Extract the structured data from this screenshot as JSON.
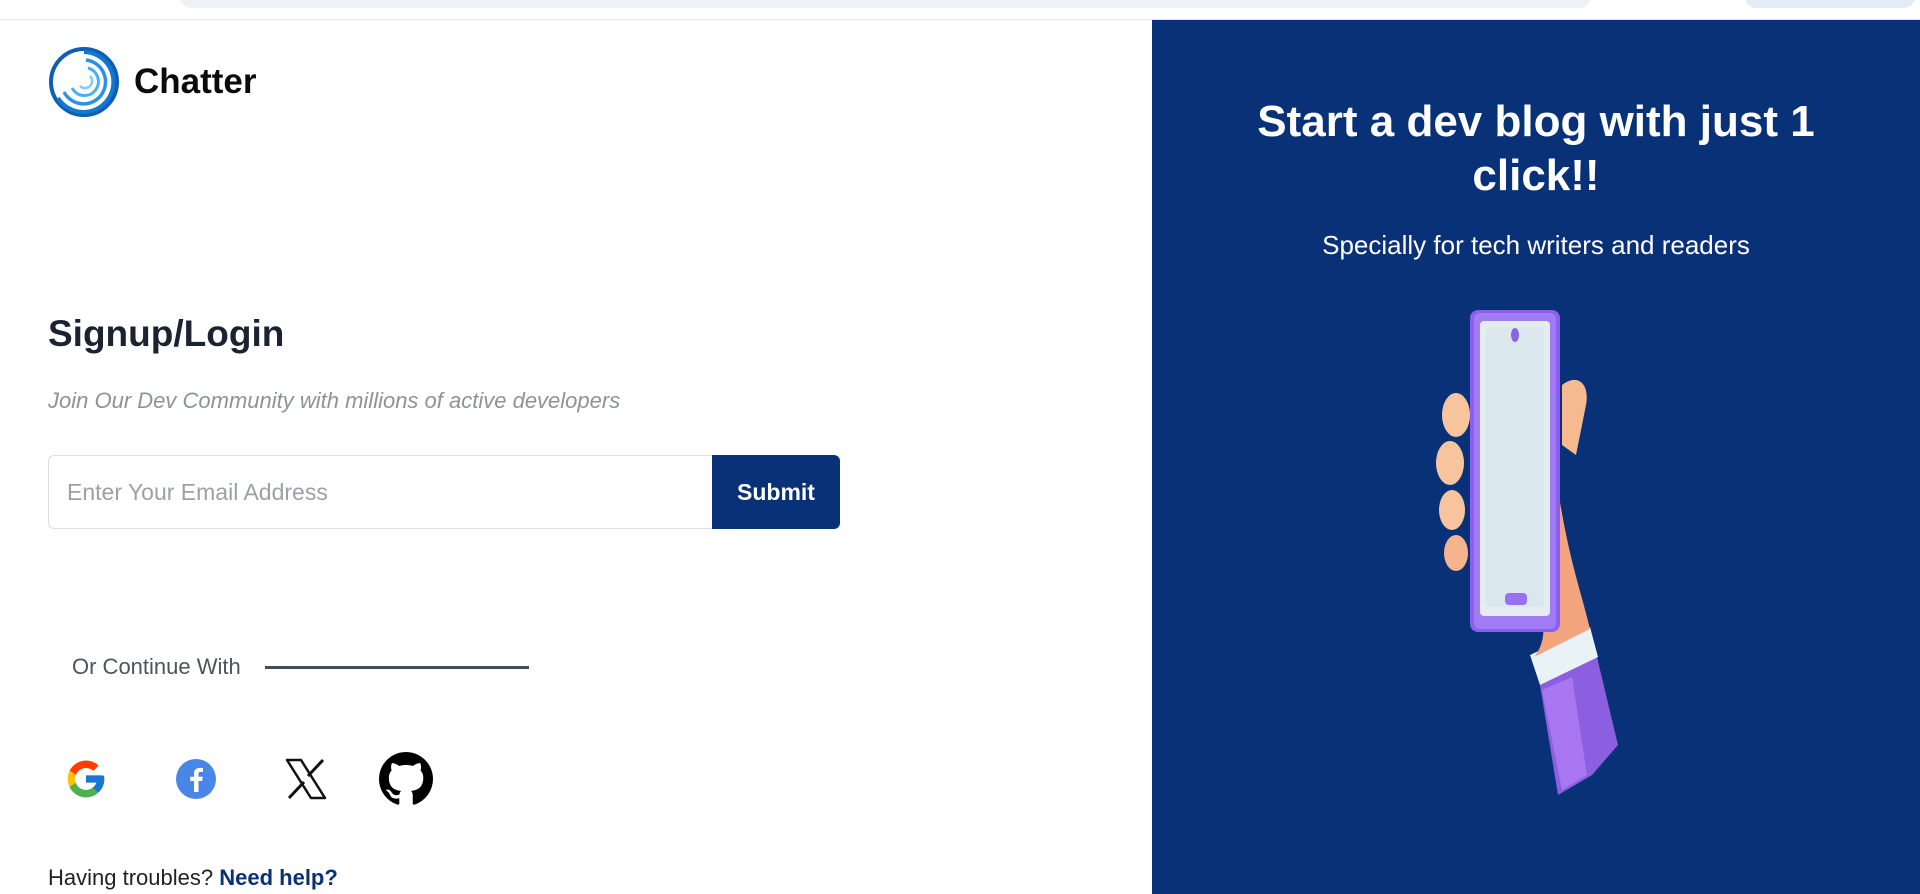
{
  "brand": {
    "name": "Chatter",
    "logo_icon": "chatter-swirl-logo-icon"
  },
  "login": {
    "heading": "Signup/Login",
    "subtitle": "Join Our Dev Community with millions of active developers",
    "email_placeholder": "Enter Your Email Address",
    "email_value": "",
    "submit_label": "Submit",
    "divider_text": "Or Continue With"
  },
  "social": [
    {
      "name": "google",
      "icon": "google-icon"
    },
    {
      "name": "facebook",
      "icon": "facebook-icon"
    },
    {
      "name": "x",
      "icon": "x-icon"
    },
    {
      "name": "github",
      "icon": "github-icon"
    }
  ],
  "help": {
    "prefix": "Having troubles?",
    "link": "Need help?"
  },
  "hero": {
    "title": "Start a dev blog with just 1 click!!",
    "subtitle": "Specially for tech writers and readers"
  },
  "colors": {
    "primary": "#083178",
    "text_dark": "#1b2333",
    "muted": "#8d939c"
  }
}
